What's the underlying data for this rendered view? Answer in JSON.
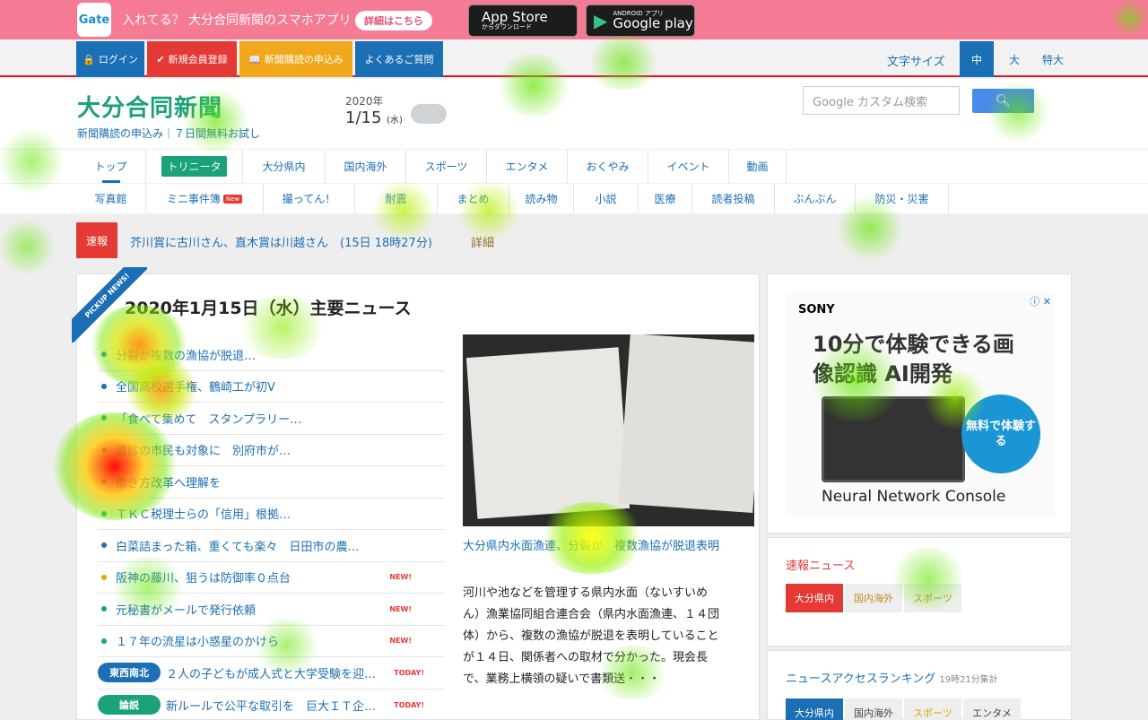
{
  "banner": {
    "logo": "Gate",
    "text": "入れてる？ 大分合同新聞のスマホアプリ",
    "detail_btn": "詳細はこちら",
    "appstore_small": "からダウンロード",
    "appstore": "App Store",
    "googleplay_small": "ANDROID アプリ",
    "googleplay": "Google play"
  },
  "utility": {
    "login": "ログイン",
    "register": "新規会員登録",
    "subscribe": "新聞購読の申込み",
    "faq": "よくあるご質問",
    "font_size_label": "文字サイズ",
    "font_sizes": [
      "中",
      "大",
      "特大"
    ]
  },
  "header": {
    "logo": "大分合同新聞",
    "sublinks": "新聞購読の申込み｜７日間無料お試し",
    "year": "2020年",
    "day": "1/15",
    "weekday": "(水)",
    "search_placeholder": "Google カスタム検索",
    "search_icon": "search-icon"
  },
  "nav1": [
    "トップ",
    "トリニータ",
    "大分県内",
    "国内海外",
    "スポーツ",
    "エンタメ",
    "おくやみ",
    "イベント",
    "動画"
  ],
  "nav2": [
    "写真館",
    "ミニ事件簿",
    "撮ってん！",
    "耐震",
    "まとめ",
    "読み物",
    "小説",
    "医療",
    "読者投稿",
    "ぶんぶん",
    "防災・災害"
  ],
  "nav2_new": "New",
  "breaking": {
    "label": "速報",
    "text": "芥川賞に古川さん、直木賞は川越さん　(15日 18時27分)",
    "more": "詳細"
  },
  "main": {
    "ribbon": "PICKUP NEWS!",
    "title": "2020年1月15日（水）主要ニュース",
    "news": [
      {
        "text": "分裂が複数の漁協が脱退…",
        "badge": "",
        "dot": "#1a6fb5"
      },
      {
        "text": "全国高校選手権、鶴崎工が初V",
        "badge": "",
        "dot": "#1a6fb5"
      },
      {
        "text": "「食べて集めて　スタンプラリー…",
        "badge": "",
        "dot": "#1aa27a"
      },
      {
        "text": "健診の市民も対象に　別府市が…",
        "badge": "",
        "dot": "#1aa27a"
      },
      {
        "text": "働き方改革へ理解を",
        "badge": "",
        "dot": "#1aa27a"
      },
      {
        "text": "ＴＫＣ税理士らの「信用」根拠…",
        "badge": "",
        "dot": "#1aa27a"
      },
      {
        "text": "白菜詰まった箱、重くても楽々　日田市の農…",
        "badge": "",
        "dot": "#1a6fb5"
      },
      {
        "text": "阪神の藤川、狙うは防御率０点台",
        "badge": "NEW!",
        "dot": "#e0a800"
      },
      {
        "text": "元秘書がメールで発行依頼",
        "badge": "NEW!",
        "dot": "#1aa27a"
      },
      {
        "text": "１７年の流星は小惑星のかけら",
        "badge": "NEW!",
        "dot": "#1aa27a"
      }
    ],
    "tagged": [
      {
        "tag": "東西南北",
        "tag_color": "#1a6fb5",
        "text": "２人の子どもが成人式と大学受験を迎…",
        "badge": "TODAY!"
      },
      {
        "tag": "論説",
        "tag_color": "#1aa27a",
        "text": "新ルールで公平な取引を　巨大ＩＴ企…",
        "badge": "TODAY!"
      }
    ],
    "photo_caption": "大分県内水面漁連、分裂か　複数漁協が脱退表明",
    "photo_desc": "河川や池などを管理する県内水面（ないすいめん）漁業協同組合連合会（県内水面漁連、１４団体）から、複数の漁協が脱退を表明していることが１４日、関係者への取材で分かった。現会長で、業務上横領の疑いで書類送・・・"
  },
  "ad": {
    "brand": "SONY",
    "close": "ⓘ ✕",
    "headline": "10分で体験できる画像認識 AI開発",
    "cta": "無料で体験する",
    "footer": "Neural Network Console"
  },
  "side": {
    "breaking_title": "速報ニュース",
    "breaking_tabs": [
      "大分県内",
      "国内海外",
      "スポーツ"
    ],
    "ranking_title": "ニュースアクセスランキング",
    "ranking_time": "19時21分集計",
    "ranking_tabs": [
      "大分県内",
      "国内海外",
      "スポーツ",
      "エンタメ"
    ]
  },
  "colors": {
    "banner": "#f57a93",
    "accent_blue": "#1a6fb5",
    "brand_green": "#1aa27a",
    "alert_red": "#e53935"
  }
}
